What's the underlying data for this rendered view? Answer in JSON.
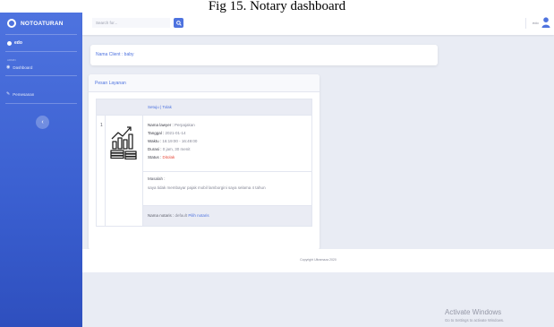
{
  "caption": "Fig 15. Notary dashboard",
  "sidebar": {
    "brand": "NOTOATURAN",
    "user": "edo",
    "heading": "ADMIN",
    "items": [
      {
        "label": "Dashboard"
      },
      {
        "label": "Pemesanan"
      }
    ]
  },
  "topbar": {
    "search_placeholder": "Search for...",
    "username": "edo"
  },
  "client": {
    "label": "Nama Client : baby"
  },
  "pesan": {
    "title": "Pesan Layanan",
    "header_actions": "Setuju | Tolak",
    "row_number": "1",
    "lawyer_label": "Nama lawyer :",
    "lawyer_value": "Perpajakan",
    "tanggal_label": "Tanggal :",
    "tanggal_value": "2021-01-14",
    "waktu_label": "Waktu :",
    "waktu_value": "16:19:00 - 16:49:00",
    "durasi_label": "Durasi :",
    "durasi_value": "0 jam, 30 menit",
    "status_label": "Status :",
    "status_value": "Ditolak",
    "masalah_label": "Masalah :",
    "masalah_text": "saya tidak membayar pajak mobil lamborgini saya selama 4 tahun",
    "notaris_label": "Nama notaris :",
    "notaris_value": "default",
    "notaris_link": "Pilih notaris"
  },
  "footer": {
    "text": "Copyright Ultramaza 2020"
  },
  "watermark": {
    "title": "Activate Windows",
    "subtitle": "Go to Settings to activate Windows."
  },
  "colors": {
    "primary": "#4e73df",
    "danger": "#e74a3b",
    "background": "#e9ecf4"
  }
}
